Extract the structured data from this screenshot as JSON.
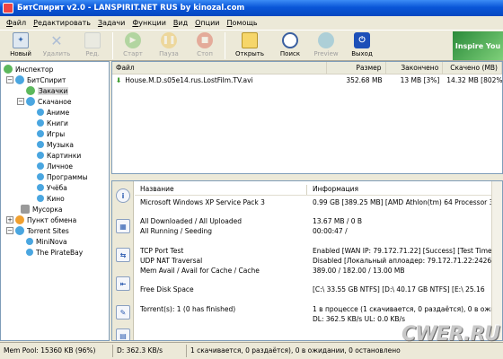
{
  "window": {
    "title": "БитСпирит v2.0 - LANSPIRIT.NET RUS by kinozal.com"
  },
  "menu": [
    "Файл",
    "Редактировать",
    "Задачи",
    "Функции",
    "Вид",
    "Опции",
    "Помощь"
  ],
  "toolbar": {
    "buttons": [
      {
        "label": "Новый",
        "icon": "new-task-icon",
        "enabled": true
      },
      {
        "label": "Удалить",
        "icon": "delete-icon",
        "enabled": false
      },
      {
        "label": "Ред.",
        "icon": "edit-icon",
        "enabled": false
      },
      {
        "label": "Старт",
        "icon": "start-icon",
        "enabled": false
      },
      {
        "label": "Пауза",
        "icon": "pause-icon",
        "enabled": false
      },
      {
        "label": "Стоп",
        "icon": "stop-icon",
        "enabled": false
      },
      {
        "label": "Открыть",
        "icon": "open-folder-icon",
        "enabled": true
      },
      {
        "label": "Поиск",
        "icon": "search-icon",
        "enabled": true
      },
      {
        "label": "Preview",
        "icon": "preview-icon",
        "enabled": false
      },
      {
        "label": "Выход",
        "icon": "exit-icon",
        "enabled": true
      }
    ],
    "banner": "Inspire You"
  },
  "tree": {
    "inspector": "Инспектор",
    "bitspirit": "БитСпирит",
    "downloads": "Закачки",
    "downloaded": "Скачаное",
    "categories": [
      "Аниме",
      "Книги",
      "Игры",
      "Музыка",
      "Картинки",
      "Личное",
      "Программы",
      "Учёба",
      "Кино"
    ],
    "trash": "Мусорка",
    "exchange": "Пункт обмена",
    "torrent_sites": "Torrent Sites",
    "sites": [
      "MiniNova",
      "The PirateBay"
    ]
  },
  "filelist": {
    "columns": {
      "file": "Файл",
      "size": "Размер",
      "done": "Закончено",
      "downloaded": "Скачено (MB)"
    },
    "rows": [
      {
        "file": "House.M.D.s05e14.rus.LostFilm.TV.avi",
        "size": "352.68 MB",
        "done": "13 MB [3%]",
        "downloaded": "14.32 MB [802%]"
      }
    ]
  },
  "info": {
    "columns": {
      "name": "Название",
      "info": "Информация"
    },
    "rows": [
      {
        "name": "Microsoft Windows XP Service Pack 3",
        "value": "0.99 GB [389.25 MB] [AMD Athlon(tm) 64 Processor 30"
      },
      {
        "name": "All Downloaded / All Uploaded",
        "value": "13.67 MB / 0 B"
      },
      {
        "name": "All Running / Seeding",
        "value": "00:00:47 /"
      },
      {
        "name": "TCP Port Test",
        "value": "Enabled [WAN IP: 79.172.71.22] [Success] [Test Time"
      },
      {
        "name": "UDP NAT Traversal",
        "value": "Disabled [Локальный аплоадер: 79.172.71.22:24260"
      },
      {
        "name": "Mem Avail / Avail for Cache / Cache",
        "value": "389.00 / 182.00 / 13.00 MB"
      },
      {
        "name": "Free Disk Space",
        "value": "[C:\\ 33.55 GB  NTFS]  [D:\\ 40.17 GB  NTFS]  [E:\\ 25.16"
      },
      {
        "name": "Torrent(s): 1 (0 has finished)",
        "value": "1 в процессе (1 скачивается, 0 раздаётся), 0 в ожи"
      },
      {
        "name": "",
        "value": "DL: 362.5 KB/s  UL: 0.0 KB/s"
      }
    ]
  },
  "status": {
    "mempool": "Mem Pool: 15360 KB (96%)",
    "dl": "D: 362.3 KB/s",
    "tasks": "1 скачивается, 0 раздаётся), 0 в ожидании, 0 остановлено",
    "watermark": "CWER.RU"
  },
  "colors": {
    "titlebar": "#0a56d8",
    "panel_bg": "#ece9d8",
    "border": "#7f9db9"
  }
}
